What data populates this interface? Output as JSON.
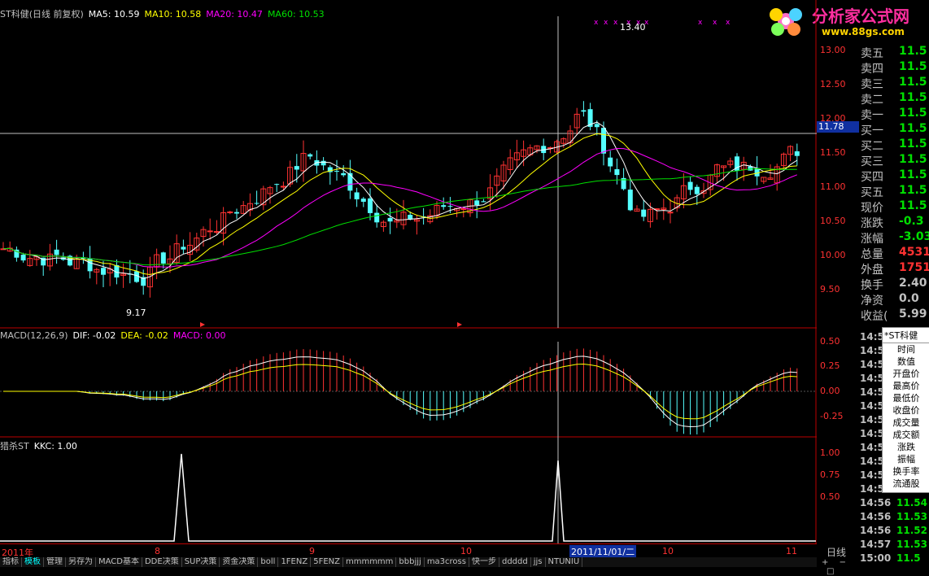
{
  "main_legend": {
    "title": "ST科健(日线 前复权)",
    "ma5": "MA5: 10.59",
    "ma10": "MA10: 10.58",
    "ma20": "MA20: 10.47",
    "ma60": "MA60: 10.53"
  },
  "macd_legend": {
    "title": "MACD(12,26,9)",
    "dif": "DIF: -0.02",
    "dea": "DEA: -0.02",
    "macd": "MACD: 0.00"
  },
  "kkc_legend": {
    "title": "猎杀ST",
    "kkc": "KKC: 1.00"
  },
  "price_axis": [
    "13.00",
    "12.50",
    "12.00",
    "11.50",
    "11.00",
    "10.50",
    "10.00",
    "9.50"
  ],
  "current_price_tag": "11.78",
  "annotations": {
    "high": "13.40",
    "low": "9.17"
  },
  "macd_axis": [
    "0.50",
    "0.25",
    "0.00",
    "-0.25"
  ],
  "kkc_axis": [
    "1.00",
    "0.75",
    "0.50"
  ],
  "date_labels": [
    "2011年",
    "8",
    "9",
    "10",
    "10",
    "11"
  ],
  "crosshair_date": "2011/11/01/二",
  "period_label": "日线",
  "logo": {
    "title": "分析家公式网",
    "url": "www.88gs.com"
  },
  "quote_panel": [
    {
      "k": "卖五",
      "v": "11.5"
    },
    {
      "k": "卖四",
      "v": "11.5"
    },
    {
      "k": "卖三",
      "v": "11.5"
    },
    {
      "k": "卖二",
      "v": "11.5"
    },
    {
      "k": "卖一",
      "v": "11.5"
    },
    {
      "k": "买一",
      "v": "11.5"
    },
    {
      "k": "买二",
      "v": "11.5"
    },
    {
      "k": "买三",
      "v": "11.5"
    },
    {
      "k": "买四",
      "v": "11.5"
    },
    {
      "k": "买五",
      "v": "11.5"
    },
    {
      "k": "现价",
      "v": "11.5"
    },
    {
      "k": "涨跌",
      "v": "-0.3"
    },
    {
      "k": "涨幅",
      "v": "-3.03"
    },
    {
      "k": "总量",
      "v": "4531"
    },
    {
      "k": "外盘",
      "v": "1751"
    },
    {
      "k": "换手",
      "v": "2.40"
    },
    {
      "k": "净资",
      "v": "0.0"
    },
    {
      "k": "收益(",
      "v": "5.99"
    }
  ],
  "time_rows": [
    {
      "t": "14:5",
      "p": ""
    },
    {
      "t": "14:5",
      "p": ""
    },
    {
      "t": "14:5",
      "p": ""
    },
    {
      "t": "14:5",
      "p": ""
    },
    {
      "t": "14:5",
      "p": ""
    },
    {
      "t": "14:5",
      "p": ""
    },
    {
      "t": "14:5",
      "p": ""
    },
    {
      "t": "14:5",
      "p": ""
    },
    {
      "t": "14:5",
      "p": ""
    },
    {
      "t": "14:5",
      "p": ""
    },
    {
      "t": "14:5",
      "p": ""
    },
    {
      "t": "14:5",
      "p": ""
    },
    {
      "t": "14:56",
      "p": "11.54"
    },
    {
      "t": "14:56",
      "p": "11.53"
    },
    {
      "t": "14:56",
      "p": "11.52"
    },
    {
      "t": "14:57",
      "p": "11.53"
    },
    {
      "t": "15:00",
      "p": "11.5"
    }
  ],
  "popup": {
    "title": "*ST科健",
    "items": [
      "时间",
      "数值",
      "开盘价",
      "最高价",
      "最低价",
      "收盘价",
      "成交量",
      "成交额",
      "涨跌",
      "振幅",
      "换手率",
      "流通股"
    ]
  },
  "bottom_tabs": [
    "指标",
    "模板",
    "管理",
    "另存为",
    "MACD基本",
    "DDE决策",
    "SUP决策",
    "资金决策",
    "boll",
    "1FENZ",
    "5FENZ",
    "mmmmmm",
    "bbbjjj",
    "ma3cross",
    "快一步",
    "ddddd",
    "jjs",
    "NTUNIU"
  ],
  "colors": {
    "up": "#ff3232",
    "down": "#54ffff",
    "ma5": "#ffffff",
    "ma10": "#ffff00",
    "ma20": "#ff00ff",
    "ma60": "#00e000"
  }
}
